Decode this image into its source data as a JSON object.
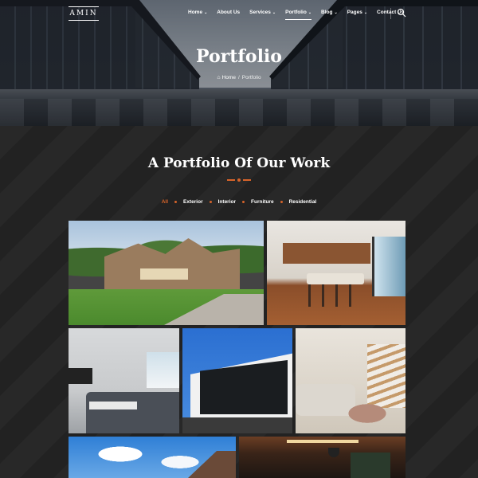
{
  "header": {
    "logo_text": "AMIN",
    "nav": [
      {
        "label": "Home",
        "dropdown": true,
        "active": false
      },
      {
        "label": "About Us",
        "dropdown": false,
        "active": false
      },
      {
        "label": "Services",
        "dropdown": true,
        "active": false
      },
      {
        "label": "Portfolio",
        "dropdown": true,
        "active": true
      },
      {
        "label": "Blog",
        "dropdown": true,
        "active": false
      },
      {
        "label": "Pages",
        "dropdown": true,
        "active": false
      },
      {
        "label": "Contact Us",
        "dropdown": false,
        "active": false
      }
    ],
    "search_icon": "search-icon"
  },
  "hero": {
    "title": "Portfolio",
    "breadcrumb": {
      "home": "Home",
      "separator": "/",
      "current": "Portfolio"
    }
  },
  "portfolio": {
    "title": "A Portfolio Of Our Work",
    "filters": [
      {
        "label": "All",
        "active": true
      },
      {
        "label": "Exterior",
        "active": false
      },
      {
        "label": "Interior",
        "active": false
      },
      {
        "label": "Furniture",
        "active": false
      },
      {
        "label": "Residential",
        "active": false
      }
    ],
    "accent_color": "#d8642a"
  },
  "gallery": [
    {
      "subject": "stone house exterior with lawn"
    },
    {
      "subject": "kitchen with wooden cabinets and bar stools"
    },
    {
      "subject": "living room with grey sofa and tv"
    },
    {
      "subject": "modern house facade with large windows"
    },
    {
      "subject": "bright living room with staircase"
    },
    {
      "subject": "blue sky with clouds and roof"
    },
    {
      "subject": "dark interior with wood ceiling"
    }
  ]
}
